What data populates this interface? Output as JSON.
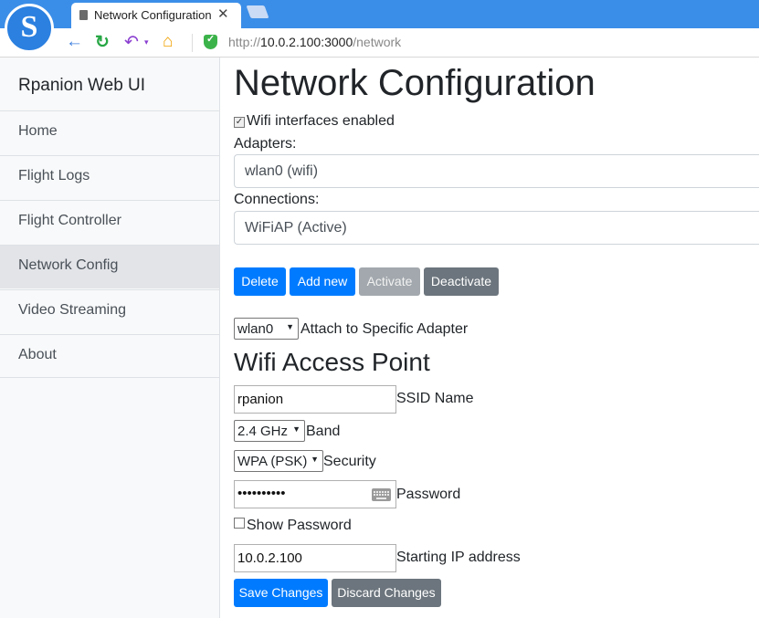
{
  "browser": {
    "tab_title": "Network Configuration",
    "tab_close": "✕",
    "url_prefix": "http://",
    "url_host": "10.0.2.100:3000",
    "url_path": "/network"
  },
  "sidebar": {
    "brand": "Rpanion Web UI",
    "items": [
      {
        "label": "Home"
      },
      {
        "label": "Flight Logs"
      },
      {
        "label": "Flight Controller"
      },
      {
        "label": "Network Config",
        "active": true
      },
      {
        "label": "Video Streaming"
      },
      {
        "label": "About"
      }
    ]
  },
  "main": {
    "title": "Network Configuration",
    "wifi_enabled_label": "Wifi interfaces enabled",
    "wifi_enabled": true,
    "adapters_label": "Adapters:",
    "adapter_value": "wlan0 (wifi)",
    "connections_label": "Connections:",
    "connection_value": "WiFiAP (Active)",
    "buttons": {
      "delete": "Delete",
      "add_new": "Add new",
      "activate": "Activate",
      "deactivate": "Deactivate"
    },
    "attach_adapter_value": "wlan0",
    "attach_adapter_label": "Attach to Specific Adapter",
    "section_title": "Wifi Access Point",
    "ssid_value": "rpanion",
    "ssid_label": "SSID Name",
    "band_value": "2.4 GHz",
    "band_label": "Band",
    "security_value": "WPA (PSK)",
    "security_label": "Security",
    "password_mask": "••••••••••",
    "password_label": "Password",
    "show_password_label": "Show Password",
    "show_password": false,
    "ip_value": "10.0.2.100",
    "ip_label": "Starting IP address",
    "save_label": "Save Changes",
    "discard_label": "Discard Changes"
  },
  "colors": {
    "primary": "#007bff",
    "secondary": "#6c757d",
    "browser_bar": "#3b8ee8"
  }
}
